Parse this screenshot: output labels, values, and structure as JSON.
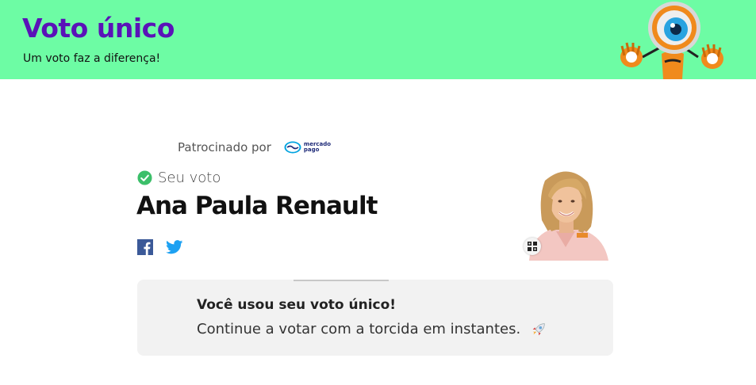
{
  "header": {
    "title": "Voto único",
    "subtitle": "Um voto faz a diferença!"
  },
  "sponsor": {
    "label": "Patrocinado por",
    "logo_line1": "mercado",
    "logo_line2": "pago"
  },
  "vote": {
    "status_label": "Seu voto",
    "candidate_name": "Ana Paula Renault"
  },
  "share": {
    "icons": [
      "facebook-icon",
      "twitter-icon"
    ]
  },
  "message": {
    "title": "Você usou seu voto único!",
    "text": "Continue a votar com a torcida em instantes."
  },
  "colors": {
    "header_bg": "#6dfca4",
    "title_color": "#5a12b8",
    "check_green": "#3cbf6a",
    "facebook_blue": "#3b5998",
    "twitter_blue": "#1da1f2",
    "message_bg": "#f2f2f2"
  }
}
